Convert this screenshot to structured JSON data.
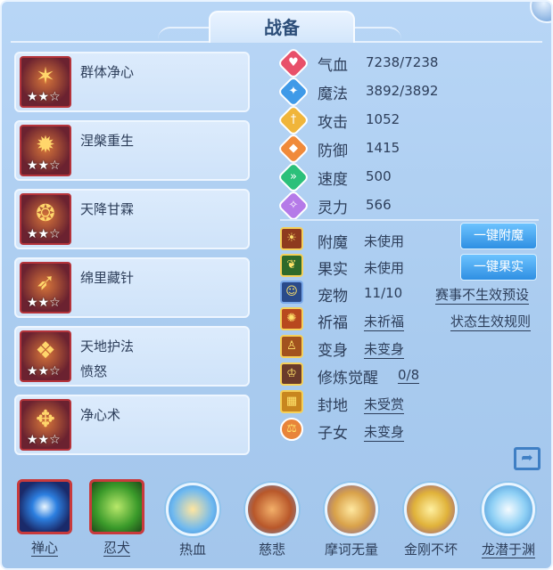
{
  "title": "战备",
  "skills": [
    {
      "name": "群体净心",
      "stars": "★★☆",
      "sub": ""
    },
    {
      "name": "涅槃重生",
      "stars": "★★☆",
      "sub": ""
    },
    {
      "name": "天降甘霖",
      "stars": "★★☆",
      "sub": ""
    },
    {
      "name": "绵里藏针",
      "stars": "★★☆",
      "sub": ""
    },
    {
      "name": "天地护法",
      "stars": "★★☆",
      "sub": "愤怒"
    },
    {
      "name": "净心术",
      "stars": "★★☆",
      "sub": ""
    }
  ],
  "stats": [
    {
      "label": "气血",
      "value": "7238/7238",
      "color": "#e8506a",
      "icon": "heart-icon",
      "glyph": "♥"
    },
    {
      "label": "魔法",
      "value": "3892/3892",
      "color": "#3f9ae8",
      "icon": "magic-icon",
      "glyph": "✦"
    },
    {
      "label": "攻击",
      "value": "1052",
      "color": "#f0b53a",
      "icon": "sword-icon",
      "glyph": "†"
    },
    {
      "label": "防御",
      "value": "1415",
      "color": "#f08a3a",
      "icon": "shield-icon",
      "glyph": "◆"
    },
    {
      "label": "速度",
      "value": "500",
      "color": "#2cc07a",
      "icon": "speed-icon",
      "glyph": "»"
    },
    {
      "label": "灵力",
      "value": "566",
      "color": "#b57ae8",
      "icon": "spirit-icon",
      "glyph": "✧"
    }
  ],
  "status": {
    "enchant": {
      "label": "附魔",
      "value": "未使用"
    },
    "fruit": {
      "label": "果实",
      "value": "未使用"
    },
    "pet": {
      "label": "宠物",
      "value": "11/10"
    },
    "blessing": {
      "label": "祈福",
      "value": "未祈福"
    },
    "transform": {
      "label": "变身",
      "value": "未变身"
    },
    "awaken": {
      "label": "修炼觉醒",
      "value": "0/8"
    },
    "fief": {
      "label": "封地",
      "value": "未受赏"
    },
    "children": {
      "label": "子女",
      "value": "未变身"
    }
  },
  "buttons": {
    "enchant": "一键附魔",
    "fruit": "一键果实",
    "event_rule": "赛事不生效预设",
    "state_rule": "状态生效规则"
  },
  "bottom": [
    {
      "label": "禅心",
      "icon": "zen-orb-icon",
      "style": "square",
      "underline": true,
      "bg": "radial-gradient(circle, #eaf6ff 0%, #2c7fe0 35%, #1a2a6a 75%)"
    },
    {
      "label": "忍犬",
      "icon": "wolf-icon",
      "style": "square",
      "underline": true,
      "bg": "radial-gradient(circle, #b8e86a 0%, #3a9a2a 60%, #1f4a1a 100%)"
    },
    {
      "label": "热血",
      "icon": "blood-fighter-icon",
      "style": "circle",
      "underline": false,
      "bg": "radial-gradient(circle, #ffe6a0 0%, #6db8f0 60%, #3d7fc7 100%)"
    },
    {
      "label": "慈悲",
      "icon": "scroll-icon",
      "style": "circle",
      "underline": false,
      "bg": "radial-gradient(circle, #f3b06a 0%, #b8572a 55%, #6b8fc7 100%)"
    },
    {
      "label": "摩诃无量",
      "icon": "monk-icon",
      "style": "circle",
      "underline": false,
      "bg": "radial-gradient(circle, #ffe8a0 0%, #d9a24a 50%, #7a5fa8 100%)"
    },
    {
      "label": "金刚不坏",
      "icon": "golden-guardian-icon",
      "style": "circle",
      "underline": false,
      "bg": "radial-gradient(circle, #fff0a0 0%, #e0b23a 50%, #8a4f9a 100%)"
    },
    {
      "label": "龙潜于渊",
      "icon": "dragon-icon",
      "style": "circle",
      "underline": true,
      "bg": "radial-gradient(circle, #f4fbff 0%, #8fd0f5 50%, #3a86cc 100%)"
    }
  ]
}
